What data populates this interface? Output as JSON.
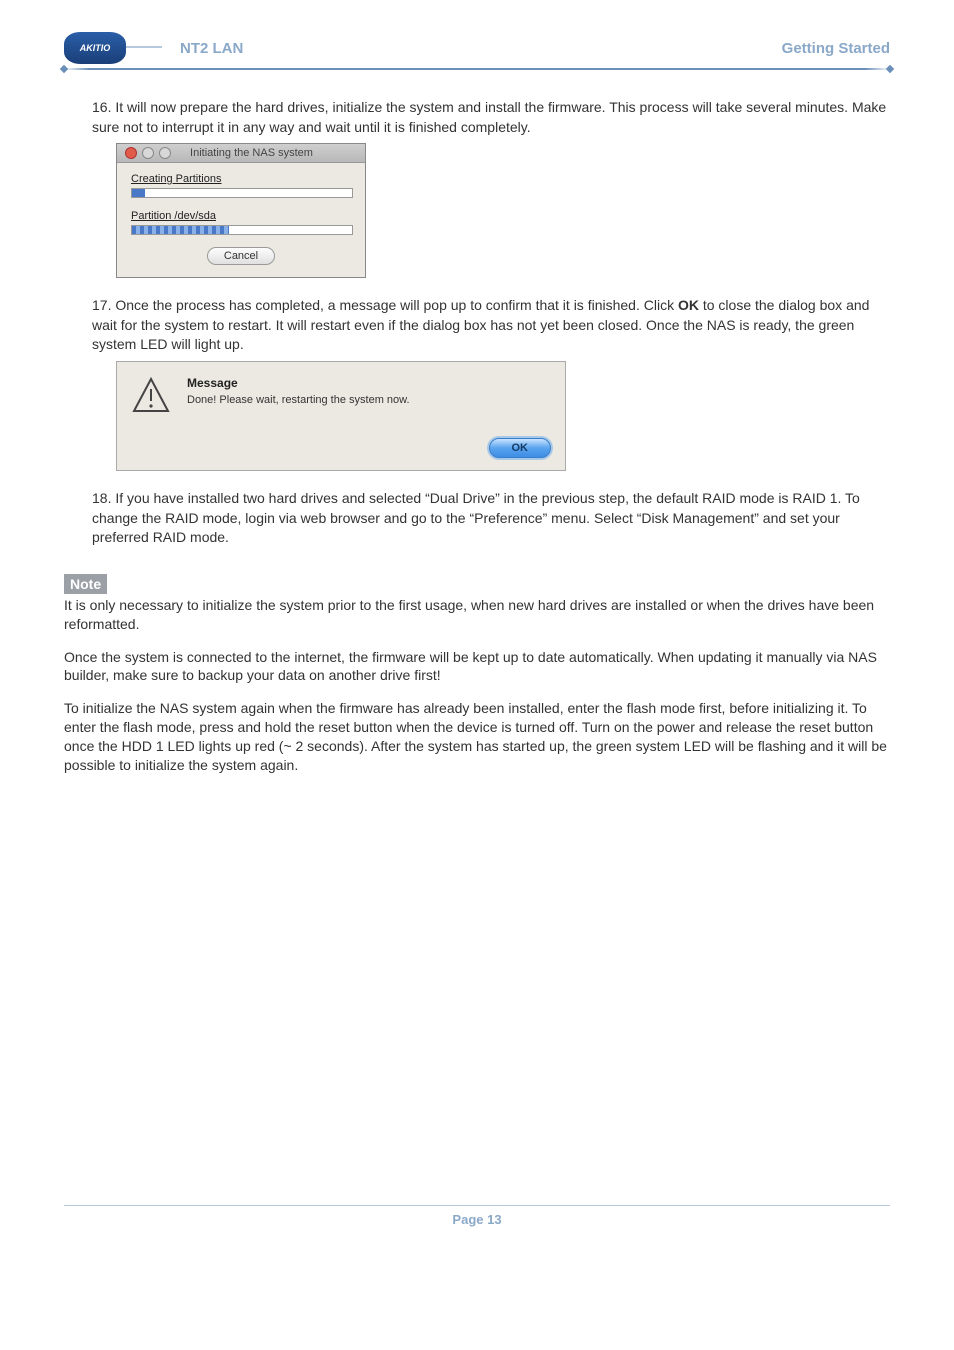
{
  "header": {
    "logo_text": "AKITIO",
    "title_left": "NT2 LAN",
    "title_right": "Getting Started"
  },
  "steps": {
    "s16": {
      "num": "16.",
      "text": " It will now prepare the hard drives, initialize the system and install the firmware. This process will take several minutes. Make sure not to interrupt it in any way and wait until it is finished completely."
    },
    "s17": {
      "num": "17.",
      "text_a": " Once the process has completed, a message will pop up to confirm that it is finished. Click ",
      "ok": "OK",
      "text_b": " to close the dialog box and wait for the system to restart. It will restart even if the dialog box has not yet been closed. Once the NAS is ready, the green system LED will light up."
    },
    "s18": {
      "num": "18.",
      "text": " If you have installed two hard drives and selected “Dual Drive” in the previous step, the default RAID mode is RAID 1. To change the RAID mode, login via web browser and go to the “Preference” menu. Select “Disk Management” and set your preferred RAID mode."
    }
  },
  "dialog1": {
    "title": "Initiating the NAS system",
    "label1": "Creating Partitions",
    "label2": "Partition /dev/sda",
    "cancel": "Cancel"
  },
  "dialog2": {
    "title": "Message",
    "text": "Done! Please wait, restarting the system now.",
    "ok": "OK"
  },
  "note": {
    "label": "Note",
    "p1": "It is only necessary to initialize the system prior to the first usage, when new hard drives are installed or when the drives have been reformatted.",
    "p2": "Once the system is connected to the internet, the firmware will be kept up to date automatically. When updating it manually via NAS builder, make sure to backup your data on another drive first!",
    "p3": "To initialize the NAS system again when the firmware has already been installed, enter the flash mode first, before initializing it. To enter the flash mode, press and hold the reset button when the device is turned off. Turn on the power and release the reset button once the HDD 1 LED lights up red (~ 2 seconds). After the system has started up, the green system LED will be flashing and it will be possible to initialize the system again."
  },
  "footer": {
    "page": "Page 13"
  }
}
